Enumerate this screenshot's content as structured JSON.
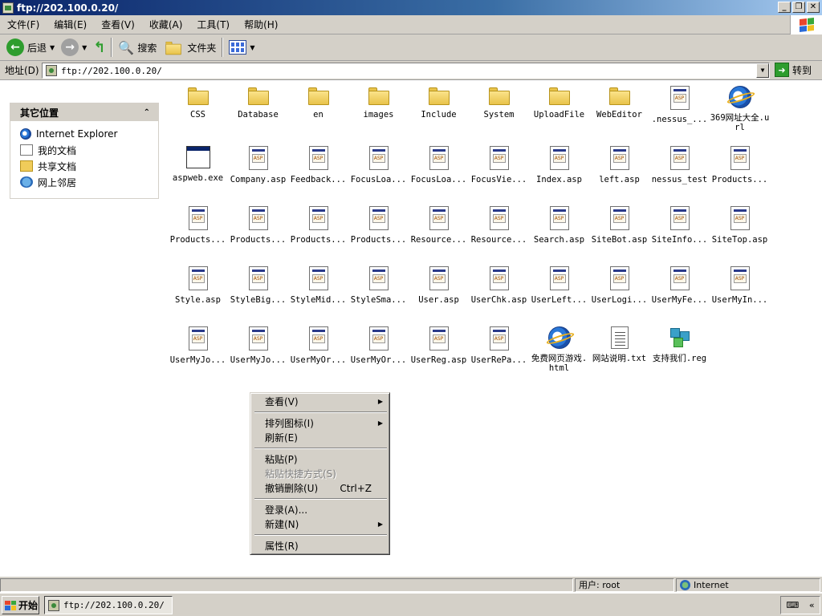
{
  "window": {
    "title": "ftp://202.100.0.20/",
    "min": "_",
    "max": "❐",
    "close": "✕"
  },
  "menubar": [
    "文件(F)",
    "编辑(E)",
    "查看(V)",
    "收藏(A)",
    "工具(T)",
    "帮助(H)"
  ],
  "toolbar": {
    "back": "后退",
    "search": "搜索",
    "folders": "文件夹"
  },
  "address": {
    "label": "地址(D)",
    "value": "ftp://202.100.0.20/",
    "go": "转到"
  },
  "panel": {
    "title": "其它位置",
    "items": [
      "Internet Explorer",
      "我的文档",
      "共享文档",
      "网上邻居"
    ]
  },
  "files": [
    {
      "name": "CSS",
      "type": "folder"
    },
    {
      "name": "Database",
      "type": "folder"
    },
    {
      "name": "en",
      "type": "folder"
    },
    {
      "name": "images",
      "type": "folder"
    },
    {
      "name": "Include",
      "type": "folder"
    },
    {
      "name": "System",
      "type": "folder"
    },
    {
      "name": "UploadFile",
      "type": "folder"
    },
    {
      "name": "WebEditor",
      "type": "folder"
    },
    {
      "name": ".nessus_...",
      "type": "doc"
    },
    {
      "name": "369网址大全.url",
      "type": "ie"
    },
    {
      "name": "aspweb.exe",
      "type": "exe"
    },
    {
      "name": "Company.asp",
      "type": "doc"
    },
    {
      "name": "Feedback...",
      "type": "doc"
    },
    {
      "name": "FocusLoa...",
      "type": "doc"
    },
    {
      "name": "FocusLoa...",
      "type": "doc"
    },
    {
      "name": "FocusVie...",
      "type": "doc"
    },
    {
      "name": "Index.asp",
      "type": "doc"
    },
    {
      "name": "left.asp",
      "type": "doc"
    },
    {
      "name": "nessus_test",
      "type": "doc"
    },
    {
      "name": "Products...",
      "type": "doc"
    },
    {
      "name": "Products...",
      "type": "doc"
    },
    {
      "name": "Products...",
      "type": "doc"
    },
    {
      "name": "Products...",
      "type": "doc"
    },
    {
      "name": "Products...",
      "type": "doc"
    },
    {
      "name": "Resource...",
      "type": "doc"
    },
    {
      "name": "Resource...",
      "type": "doc"
    },
    {
      "name": "Search.asp",
      "type": "doc"
    },
    {
      "name": "SiteBot.asp",
      "type": "doc"
    },
    {
      "name": "SiteInfo...",
      "type": "doc"
    },
    {
      "name": "SiteTop.asp",
      "type": "doc"
    },
    {
      "name": "Style.asp",
      "type": "doc"
    },
    {
      "name": "StyleBig...",
      "type": "doc"
    },
    {
      "name": "StyleMid...",
      "type": "doc"
    },
    {
      "name": "StyleSma...",
      "type": "doc"
    },
    {
      "name": "User.asp",
      "type": "doc"
    },
    {
      "name": "UserChk.asp",
      "type": "doc"
    },
    {
      "name": "UserLeft...",
      "type": "doc"
    },
    {
      "name": "UserLogi...",
      "type": "doc"
    },
    {
      "name": "UserMyFe...",
      "type": "doc"
    },
    {
      "name": "UserMyIn...",
      "type": "doc"
    },
    {
      "name": "UserMyJo...",
      "type": "doc"
    },
    {
      "name": "UserMyJo...",
      "type": "doc"
    },
    {
      "name": "UserMyOr...",
      "type": "doc"
    },
    {
      "name": "UserMyOr...",
      "type": "doc"
    },
    {
      "name": "UserReg.asp",
      "type": "doc"
    },
    {
      "name": "UserRePa...",
      "type": "doc"
    },
    {
      "name": "免费网页游戏.html",
      "type": "ie"
    },
    {
      "name": "网站说明.txt",
      "type": "txt"
    },
    {
      "name": "支持我们.reg",
      "type": "reg"
    }
  ],
  "context_menu": [
    {
      "label": "查看(V)",
      "submenu": true
    },
    {
      "sep": true
    },
    {
      "label": "排列图标(I)",
      "submenu": true
    },
    {
      "label": "刷新(E)"
    },
    {
      "sep": true
    },
    {
      "label": "粘贴(P)"
    },
    {
      "label": "粘贴快捷方式(S)",
      "disabled": true
    },
    {
      "label": "撤销删除(U)",
      "shortcut": "Ctrl+Z"
    },
    {
      "sep": true
    },
    {
      "label": "登录(A)..."
    },
    {
      "label": "新建(N)",
      "submenu": true
    },
    {
      "sep": true
    },
    {
      "label": "属性(R)"
    }
  ],
  "status": {
    "user": "用户: root",
    "zone": "Internet"
  },
  "taskbar": {
    "start": "开始",
    "task": "ftp://202.100.0.20/"
  }
}
